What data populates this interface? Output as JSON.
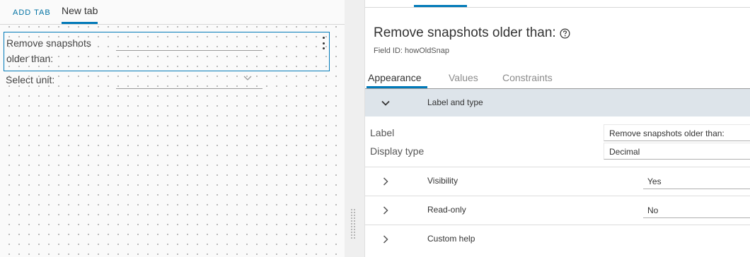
{
  "canvas": {
    "add_tab_label": "ADD TAB",
    "active_tab_label": "New tab",
    "field_label": "Remove snapshots older than:",
    "unit_label": "Select unit:"
  },
  "properties": {
    "title": "Remove snapshots older than:",
    "field_id": "Field ID: howOldSnap",
    "tabs": [
      "Appearance",
      "Values",
      "Constraints"
    ],
    "active_tab": "Appearance",
    "label_and_type": {
      "section_title": "Label and type",
      "label_caption": "Label",
      "label_value": "Remove snapshots older than:",
      "display_type_caption": "Display type",
      "display_type_value": "Decimal"
    },
    "visibility": {
      "title": "Visibility",
      "value": "Yes"
    },
    "read_only": {
      "title": "Read-only",
      "value": "No"
    },
    "custom_help": {
      "title": "Custom help"
    }
  },
  "colors": {
    "accent": "#0079b8",
    "link": "#0072a3",
    "section_bg": "#dde4ea"
  }
}
